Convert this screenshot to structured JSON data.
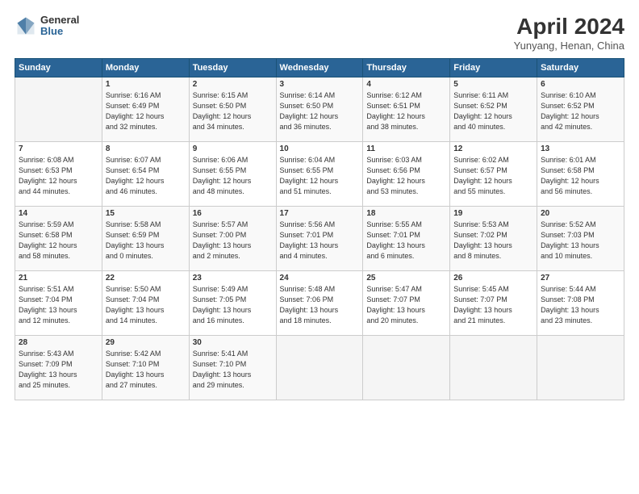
{
  "logo": {
    "general": "General",
    "blue": "Blue"
  },
  "title": "April 2024",
  "subtitle": "Yunyang, Henan, China",
  "header_days": [
    "Sunday",
    "Monday",
    "Tuesday",
    "Wednesday",
    "Thursday",
    "Friday",
    "Saturday"
  ],
  "weeks": [
    [
      {
        "day": "",
        "info": ""
      },
      {
        "day": "1",
        "info": "Sunrise: 6:16 AM\nSunset: 6:49 PM\nDaylight: 12 hours\nand 32 minutes."
      },
      {
        "day": "2",
        "info": "Sunrise: 6:15 AM\nSunset: 6:50 PM\nDaylight: 12 hours\nand 34 minutes."
      },
      {
        "day": "3",
        "info": "Sunrise: 6:14 AM\nSunset: 6:50 PM\nDaylight: 12 hours\nand 36 minutes."
      },
      {
        "day": "4",
        "info": "Sunrise: 6:12 AM\nSunset: 6:51 PM\nDaylight: 12 hours\nand 38 minutes."
      },
      {
        "day": "5",
        "info": "Sunrise: 6:11 AM\nSunset: 6:52 PM\nDaylight: 12 hours\nand 40 minutes."
      },
      {
        "day": "6",
        "info": "Sunrise: 6:10 AM\nSunset: 6:52 PM\nDaylight: 12 hours\nand 42 minutes."
      }
    ],
    [
      {
        "day": "7",
        "info": "Sunrise: 6:08 AM\nSunset: 6:53 PM\nDaylight: 12 hours\nand 44 minutes."
      },
      {
        "day": "8",
        "info": "Sunrise: 6:07 AM\nSunset: 6:54 PM\nDaylight: 12 hours\nand 46 minutes."
      },
      {
        "day": "9",
        "info": "Sunrise: 6:06 AM\nSunset: 6:55 PM\nDaylight: 12 hours\nand 48 minutes."
      },
      {
        "day": "10",
        "info": "Sunrise: 6:04 AM\nSunset: 6:55 PM\nDaylight: 12 hours\nand 51 minutes."
      },
      {
        "day": "11",
        "info": "Sunrise: 6:03 AM\nSunset: 6:56 PM\nDaylight: 12 hours\nand 53 minutes."
      },
      {
        "day": "12",
        "info": "Sunrise: 6:02 AM\nSunset: 6:57 PM\nDaylight: 12 hours\nand 55 minutes."
      },
      {
        "day": "13",
        "info": "Sunrise: 6:01 AM\nSunset: 6:58 PM\nDaylight: 12 hours\nand 56 minutes."
      }
    ],
    [
      {
        "day": "14",
        "info": "Sunrise: 5:59 AM\nSunset: 6:58 PM\nDaylight: 12 hours\nand 58 minutes."
      },
      {
        "day": "15",
        "info": "Sunrise: 5:58 AM\nSunset: 6:59 PM\nDaylight: 13 hours\nand 0 minutes."
      },
      {
        "day": "16",
        "info": "Sunrise: 5:57 AM\nSunset: 7:00 PM\nDaylight: 13 hours\nand 2 minutes."
      },
      {
        "day": "17",
        "info": "Sunrise: 5:56 AM\nSunset: 7:01 PM\nDaylight: 13 hours\nand 4 minutes."
      },
      {
        "day": "18",
        "info": "Sunrise: 5:55 AM\nSunset: 7:01 PM\nDaylight: 13 hours\nand 6 minutes."
      },
      {
        "day": "19",
        "info": "Sunrise: 5:53 AM\nSunset: 7:02 PM\nDaylight: 13 hours\nand 8 minutes."
      },
      {
        "day": "20",
        "info": "Sunrise: 5:52 AM\nSunset: 7:03 PM\nDaylight: 13 hours\nand 10 minutes."
      }
    ],
    [
      {
        "day": "21",
        "info": "Sunrise: 5:51 AM\nSunset: 7:04 PM\nDaylight: 13 hours\nand 12 minutes."
      },
      {
        "day": "22",
        "info": "Sunrise: 5:50 AM\nSunset: 7:04 PM\nDaylight: 13 hours\nand 14 minutes."
      },
      {
        "day": "23",
        "info": "Sunrise: 5:49 AM\nSunset: 7:05 PM\nDaylight: 13 hours\nand 16 minutes."
      },
      {
        "day": "24",
        "info": "Sunrise: 5:48 AM\nSunset: 7:06 PM\nDaylight: 13 hours\nand 18 minutes."
      },
      {
        "day": "25",
        "info": "Sunrise: 5:47 AM\nSunset: 7:07 PM\nDaylight: 13 hours\nand 20 minutes."
      },
      {
        "day": "26",
        "info": "Sunrise: 5:45 AM\nSunset: 7:07 PM\nDaylight: 13 hours\nand 21 minutes."
      },
      {
        "day": "27",
        "info": "Sunrise: 5:44 AM\nSunset: 7:08 PM\nDaylight: 13 hours\nand 23 minutes."
      }
    ],
    [
      {
        "day": "28",
        "info": "Sunrise: 5:43 AM\nSunset: 7:09 PM\nDaylight: 13 hours\nand 25 minutes."
      },
      {
        "day": "29",
        "info": "Sunrise: 5:42 AM\nSunset: 7:10 PM\nDaylight: 13 hours\nand 27 minutes."
      },
      {
        "day": "30",
        "info": "Sunrise: 5:41 AM\nSunset: 7:10 PM\nDaylight: 13 hours\nand 29 minutes."
      },
      {
        "day": "",
        "info": ""
      },
      {
        "day": "",
        "info": ""
      },
      {
        "day": "",
        "info": ""
      },
      {
        "day": "",
        "info": ""
      }
    ]
  ]
}
